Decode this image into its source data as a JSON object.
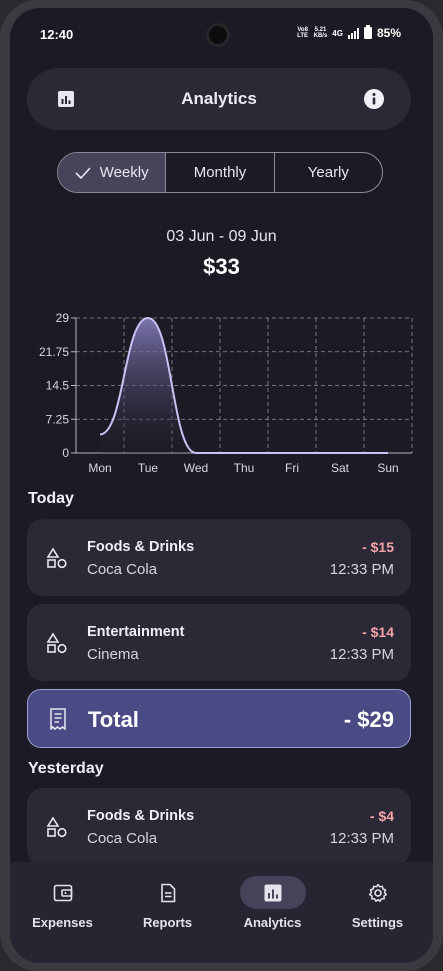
{
  "status_bar": {
    "time": "12:40",
    "volte": "Vo8 LTE",
    "speed_value": "5.21",
    "speed_unit": "KB/s",
    "network": "4G",
    "battery": "85%"
  },
  "app_bar": {
    "title": "Analytics",
    "left_icon": "bar-chart-icon",
    "right_icon": "info-icon"
  },
  "period_tabs": [
    {
      "label": "Weekly",
      "selected": true
    },
    {
      "label": "Monthly",
      "selected": false
    },
    {
      "label": "Yearly",
      "selected": false
    }
  ],
  "summary": {
    "date_range": "03 Jun - 09 Jun",
    "total_spent": "$33"
  },
  "chart_data": {
    "type": "line",
    "categories": [
      "Mon",
      "Tue",
      "Wed",
      "Thu",
      "Fri",
      "Sat",
      "Sun"
    ],
    "values": [
      4,
      29,
      0,
      0,
      0,
      0,
      0
    ],
    "y_ticks": [
      "0",
      "7.25",
      "14.5",
      "21.75",
      "29"
    ],
    "ylim": [
      0,
      29
    ],
    "grid": true,
    "fill": "gradient",
    "line_color": "#c8c3f3"
  },
  "sections": [
    {
      "heading": "Today",
      "transactions": [
        {
          "category": "Foods & Drinks",
          "description": "Coca Cola",
          "amount": "- $15",
          "time": "12:33 PM",
          "icon": "shapes-icon"
        },
        {
          "category": "Entertainment",
          "description": "Cinema",
          "amount": "- $14",
          "time": "12:33 PM",
          "icon": "shapes-icon"
        }
      ],
      "total": {
        "label": "Total",
        "amount": "- $29",
        "icon": "receipt-icon"
      }
    },
    {
      "heading": "Yesterday",
      "transactions": [
        {
          "category": "Foods & Drinks",
          "description": "Coca Cola",
          "amount": "- $4",
          "time": "12:33 PM",
          "icon": "shapes-icon"
        }
      ]
    }
  ],
  "bottom_nav": [
    {
      "label": "Expenses",
      "icon": "wallet-icon",
      "active": false
    },
    {
      "label": "Reports",
      "icon": "document-icon",
      "active": false
    },
    {
      "label": "Analytics",
      "icon": "bar-chart-icon",
      "active": true
    },
    {
      "label": "Settings",
      "icon": "gear-icon",
      "active": false
    }
  ],
  "colors": {
    "background": "#1c1b25",
    "card": "#2a2935",
    "accent": "#4a4b85",
    "expense": "#f3a3a8"
  }
}
